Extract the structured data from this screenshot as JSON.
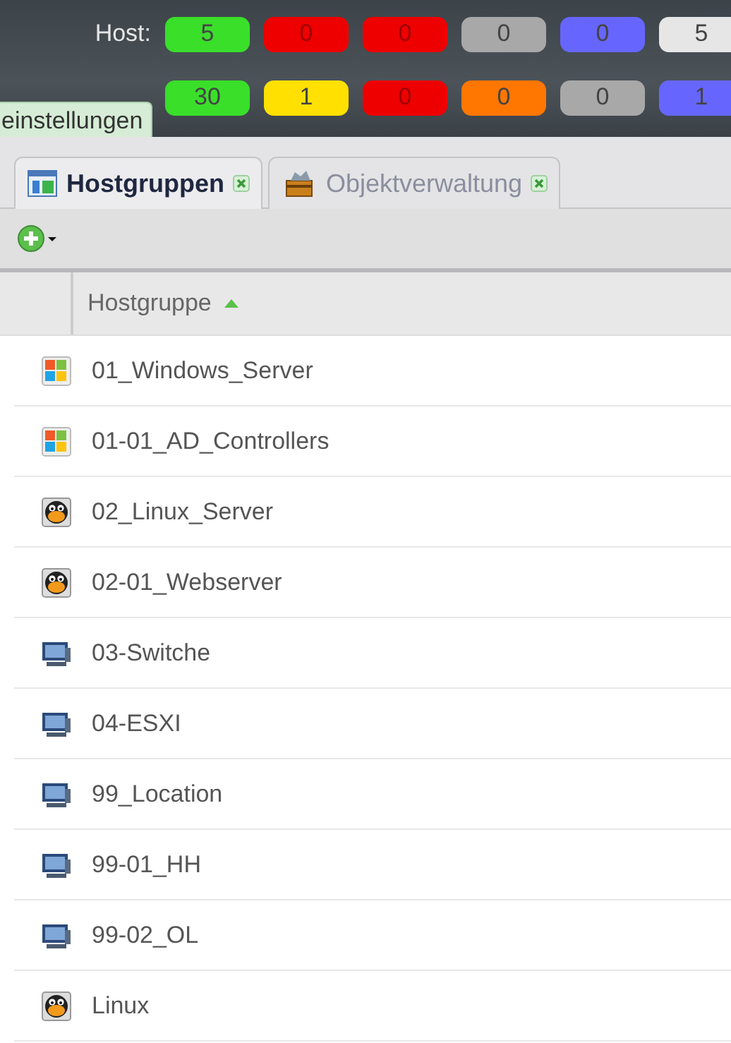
{
  "status_bar": {
    "host_label": "Host:",
    "host_counts": [
      {
        "value": "5",
        "color": "#3adf2a"
      },
      {
        "value": "0",
        "color": "#ee0000"
      },
      {
        "value": "0",
        "color": "#ee0000"
      },
      {
        "value": "0",
        "color": "#a8a8a8"
      },
      {
        "value": "0",
        "color": "#6666ff"
      },
      {
        "value": "5",
        "color": "#e6e6e6"
      }
    ],
    "service_counts": [
      {
        "value": "30",
        "color": "#3adf2a"
      },
      {
        "value": "1",
        "color": "#ffe000"
      },
      {
        "value": "0",
        "color": "#ee0000"
      },
      {
        "value": "0",
        "color": "#ff7700"
      },
      {
        "value": "0",
        "color": "#a8a8a8"
      },
      {
        "value": "1",
        "color": "#6666ff"
      }
    ]
  },
  "tooltip": "einstellungen",
  "tabs": [
    {
      "label": "Hostgruppen",
      "selected": true,
      "kind": "grid"
    },
    {
      "label": "Objektverwaltung",
      "selected": false,
      "kind": "box"
    }
  ],
  "table": {
    "columns": [
      {
        "label": "Hostgruppe",
        "sort_ascending": true
      }
    ],
    "rows": [
      {
        "name": "01_Windows_Server",
        "kind": "windows"
      },
      {
        "name": "01-01_AD_Controllers",
        "kind": "windows"
      },
      {
        "name": "02_Linux_Server",
        "kind": "linux"
      },
      {
        "name": "02-01_Webserver",
        "kind": "linux"
      },
      {
        "name": "03-Switche",
        "kind": "monitor"
      },
      {
        "name": "04-ESXI",
        "kind": "monitor"
      },
      {
        "name": "99_Location",
        "kind": "monitor"
      },
      {
        "name": "99-01_HH",
        "kind": "monitor"
      },
      {
        "name": "99-02_OL",
        "kind": "monitor"
      },
      {
        "name": "Linux",
        "kind": "linux"
      }
    ]
  }
}
